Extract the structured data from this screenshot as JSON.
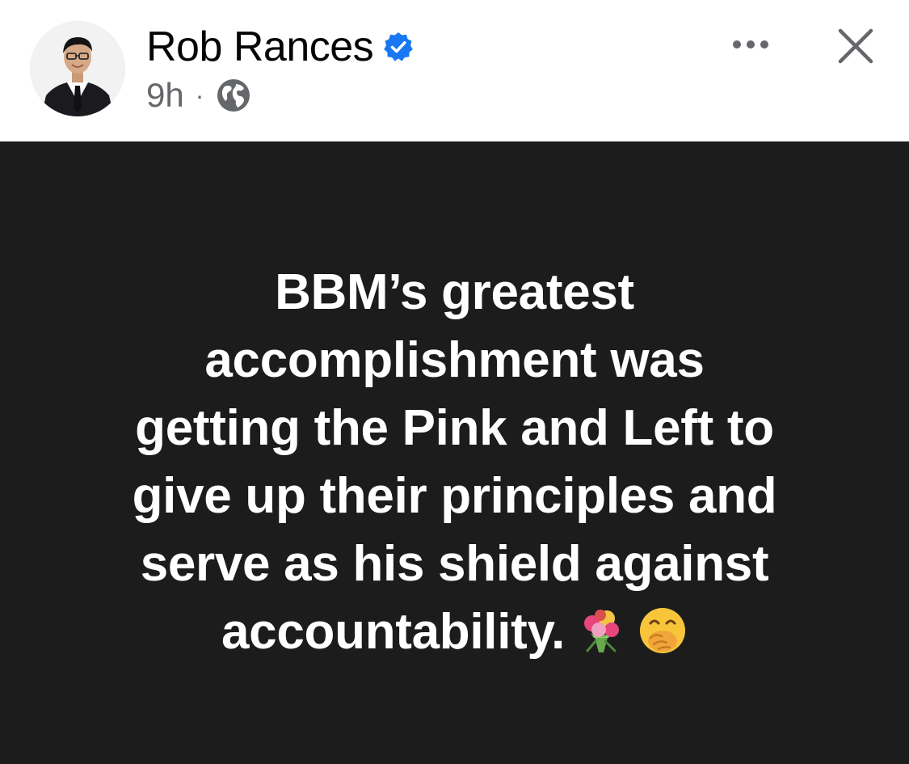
{
  "header": {
    "author_name": "Rob Rances",
    "timestamp": "9h",
    "separator": "·",
    "privacy_icon": "globe-icon",
    "verified_icon": "verified-badge-icon",
    "more_icon": "more-horizontal-icon",
    "close_icon": "close-icon",
    "accent_color": "#1877f2"
  },
  "post": {
    "background_color": "#1c1c1c",
    "text_color": "#ffffff",
    "lines": [
      "BBM’s greatest",
      "accomplishment was",
      "getting the Pink and Left to",
      "give up their principles and",
      "serve as his shield against",
      "accountability."
    ],
    "emojis": [
      "bouquet-emoji",
      "face-with-hand-over-mouth-emoji"
    ]
  }
}
